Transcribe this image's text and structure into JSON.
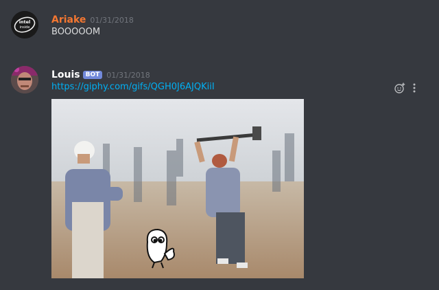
{
  "messages": [
    {
      "author": "Ariake",
      "author_color": "#f57731",
      "timestamp": "01/31/2018",
      "text": "BOOOOOM",
      "avatar_icon": "intel-logo-avatar"
    },
    {
      "author": "Louis",
      "author_color": "#ffffff",
      "bot_tag": "BOT",
      "timestamp": "01/31/2018",
      "link": "https://giphy.com/gifs/QGH0J6AJQKiiI",
      "avatar_icon": "user-photo-avatar",
      "embed_icon": "giphy-gif-sledgehammer"
    }
  ],
  "actions": {
    "reaction_icon": "add-reaction-icon",
    "more_icon": "more-options-icon"
  }
}
